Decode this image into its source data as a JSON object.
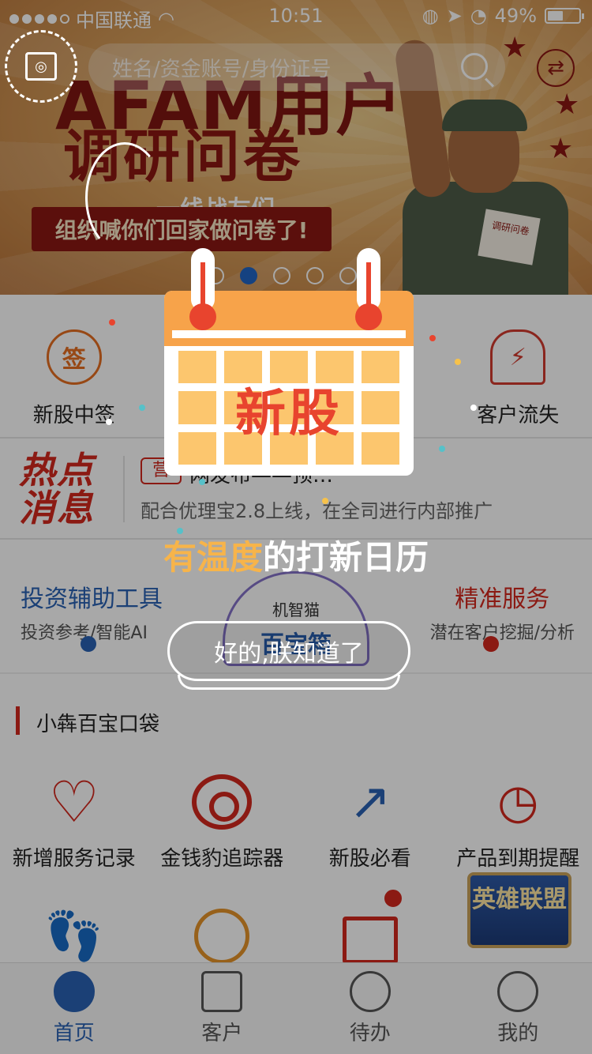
{
  "status_bar": {
    "carrier": "中国联通",
    "time": "10:51",
    "battery": "49%",
    "battery_level": 0.49
  },
  "banner": {
    "search_placeholder": "姓名/资金账号/身份证号",
    "title_line1": "AFAM用户",
    "title_line2": "调研问卷",
    "subtitle": "一线战友们",
    "ribbon": "组织喊你们回家做问卷了!",
    "paper_text": "调研问卷",
    "slide_count": 5,
    "active_slide": 1
  },
  "features": [
    {
      "label": "新股中签",
      "glyph": "签"
    },
    {
      "label": "",
      "glyph": ""
    },
    {
      "label": "",
      "glyph": ""
    },
    {
      "label": "客户流失",
      "glyph": "⚡"
    }
  ],
  "news": {
    "logo": "热点消息",
    "tag": "营",
    "line1": "网发布——预…",
    "line2": "配合优理宝2.8上线，在全司进行内部推广"
  },
  "service": {
    "left_title": "投资辅助工具",
    "left_sub": "投资参考/智能AI",
    "center_top": "机智猫",
    "center_main": "百宝箱",
    "right_title": "精准服务",
    "right_sub": "潜在客户挖掘/分析"
  },
  "pocket": {
    "title": "小犇百宝口袋",
    "items": [
      {
        "label": "新增服务记录"
      },
      {
        "label": "金钱豹追踪器"
      },
      {
        "label": "新股必看"
      },
      {
        "label": "产品到期提醒"
      },
      {
        "label": ""
      },
      {
        "label": ""
      },
      {
        "label": ""
      },
      {
        "label": ""
      }
    ]
  },
  "game_badge": "英雄联盟",
  "tabs": [
    {
      "label": "首页",
      "active": true
    },
    {
      "label": "客户",
      "active": false
    },
    {
      "label": "待办",
      "active": false
    },
    {
      "label": "我的",
      "active": false
    }
  ],
  "modal": {
    "calendar_word": "新股",
    "caption_highlight": "有温度",
    "caption_rest": "的打新日历",
    "button": "好的,朕知道了"
  },
  "colors": {
    "accent_blue": "#2a62b3",
    "accent_red": "#d3281e",
    "calendar_orange": "#f7a34a"
  }
}
